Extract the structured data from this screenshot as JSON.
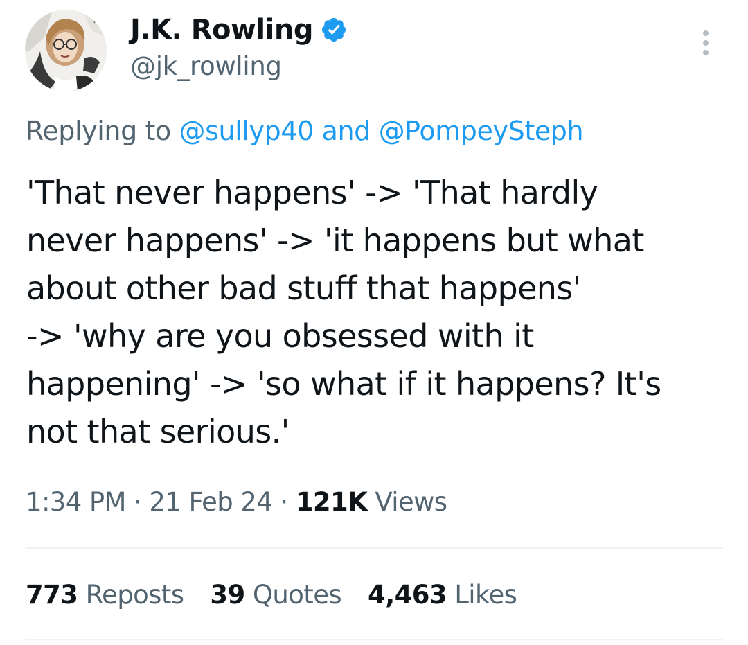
{
  "author": {
    "display_name": "J.K. Rowling",
    "handle": "@jk_rowling",
    "verified_icon": "verified-badge-icon",
    "verified_color": "#1d9bf0"
  },
  "reply": {
    "prefix": "Replying to",
    "mention_1": "@sullyp40",
    "joiner": "and",
    "mention_2": "@PompeySteph"
  },
  "tweet": {
    "lines": [
      "'That never happens' -> 'That hardly",
      "never happens' -> 'it happens but what",
      "about other bad stuff that happens'",
      "-> 'why are you obsessed with it",
      "happening' -> 'so what if it happens? It's",
      "not that serious.'"
    ]
  },
  "meta": {
    "time": "1:34 PM",
    "date": "21 Feb 24",
    "views_count": "121K",
    "views_label": "Views",
    "separator": "·"
  },
  "stats": {
    "reposts_count": "773",
    "reposts_label": "Reposts",
    "quotes_count": "39",
    "quotes_label": "Quotes",
    "likes_count": "4,463",
    "likes_label": "Likes"
  },
  "colors": {
    "text_primary": "#0f1419",
    "text_secondary": "#536471",
    "accent": "#1d9bf0",
    "divider": "#eff3f4"
  }
}
